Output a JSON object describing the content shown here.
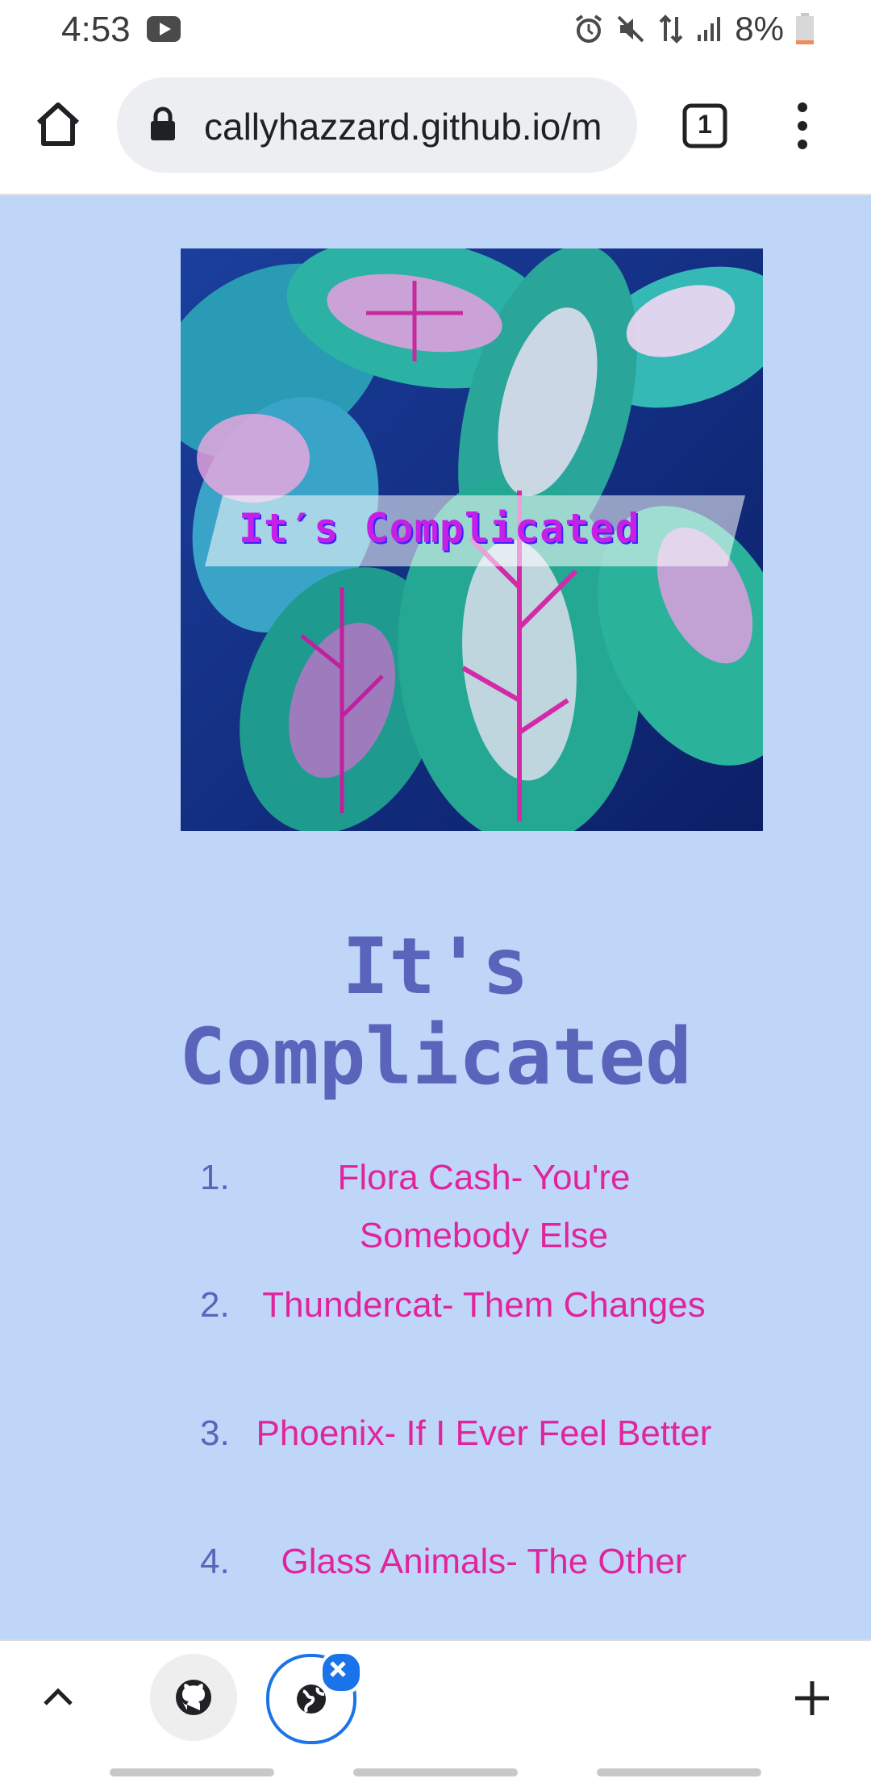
{
  "status_bar": {
    "time": "4:53",
    "battery": "8%"
  },
  "browser": {
    "url": "callyhazzard.github.io/m",
    "tab_count": "1"
  },
  "playlist": {
    "cover_title": "It′s Complicated",
    "title": "It's Complicated",
    "tracks": [
      {
        "number": "1.",
        "title": "Flora Cash- You're Somebody Else"
      },
      {
        "number": "2.",
        "title": "Thundercat- Them Changes"
      },
      {
        "number": "3.",
        "title": "Phoenix- If I Ever Feel Better"
      },
      {
        "number": "4.",
        "title": "Glass Animals- The Other"
      }
    ]
  },
  "bottom_bar": {
    "chips": [
      "github-chip",
      "website-chip"
    ]
  },
  "colors": {
    "page_bg": "#c0d6f9",
    "title": "#5b64bb",
    "track_link": "#e0259c",
    "accent": "#1a73e8"
  }
}
